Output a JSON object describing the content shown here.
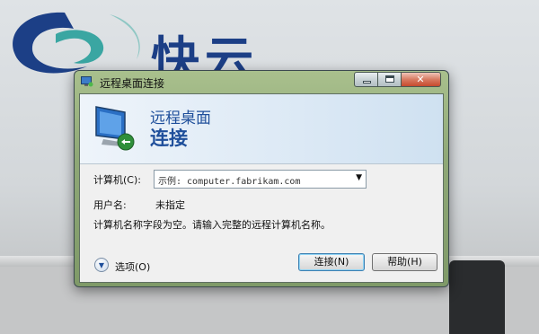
{
  "background": {
    "brand_text": "快云",
    "colors": {
      "logo_blue": "#1c3f86",
      "logo_teal": "#3aa6a2"
    }
  },
  "window": {
    "title": "远程桌面连接",
    "icon": "remote-desktop-icon",
    "caption_buttons": {
      "minimize": "minimize-icon",
      "maximize": "maximize-icon",
      "close": "✕"
    }
  },
  "banner": {
    "line1": "远程桌面",
    "line2": "连接",
    "icon": "remote-desktop-monitor-icon",
    "title_color": "#1f4f9b"
  },
  "form": {
    "computer_label": "计算机(C):",
    "computer_value": "示例: computer.fabrikam.com",
    "dropdown_icon": "▼",
    "username_label": "用户名:",
    "username_value": "未指定",
    "message": "计算机名称字段为空。请输入完整的远程计算机名称。"
  },
  "footer": {
    "options_label": "选项(O)",
    "options_icon": "chevron-down-icon",
    "connect_label": "连接(N)",
    "help_label": "帮助(H)"
  }
}
